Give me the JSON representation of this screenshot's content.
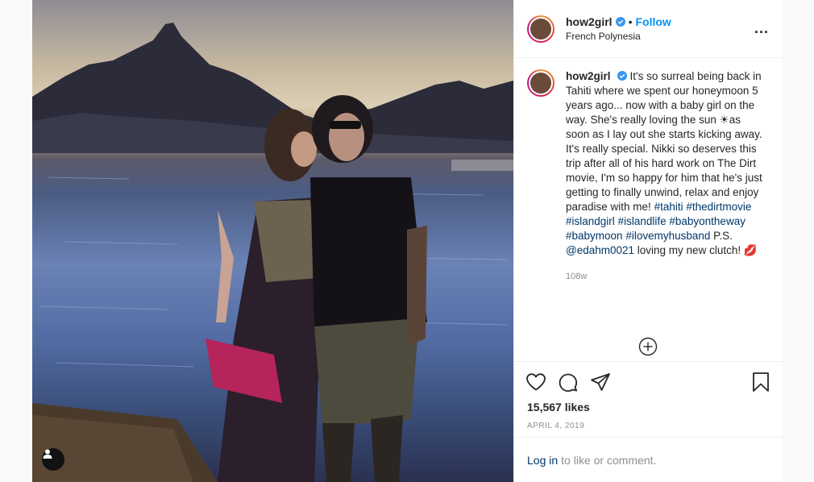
{
  "header": {
    "username": "how2girl",
    "follow_label": "Follow",
    "dot": "•",
    "location": "French Polynesia",
    "more_label": "..."
  },
  "caption": {
    "username": "how2girl",
    "text": "It's so surreal being back in Tahiti where we spent our honeymoon 5 years ago... now with a baby girl on the way. She's really loving the sun ☀as soon as I lay out she starts kicking away. It's really special. Nikki so deserves this trip after all of his hard work on The Dirt movie, I'm so happy for him that he's just getting to finally unwind, relax and enjoy paradise with me!",
    "hashtags": [
      "#tahiti",
      "#thedirtmovie",
      "#islandgirl",
      "#islandlife",
      "#babyontheway",
      "#babymoon",
      "#ilovemyhusband"
    ],
    "ps_text": "P.S.",
    "mention": "@edahm0021",
    "tail_text": "loving my new clutch! 💋",
    "time": "108w"
  },
  "stats": {
    "likes": "15,567 likes",
    "date": "APRIL 4, 2019"
  },
  "comment_bar": {
    "login_label": "Log in",
    "rest_text": "to like or comment."
  },
  "icons": {
    "verified": "verified-badge-icon",
    "like": "heart-icon",
    "comment": "comment-icon",
    "share": "paper-plane-icon",
    "save": "bookmark-icon",
    "load_more": "plus-circle-icon",
    "user_tag": "user-icon"
  },
  "colors": {
    "accent": "#0095f6",
    "link": "#00376b",
    "muted": "#8e8e8e"
  }
}
